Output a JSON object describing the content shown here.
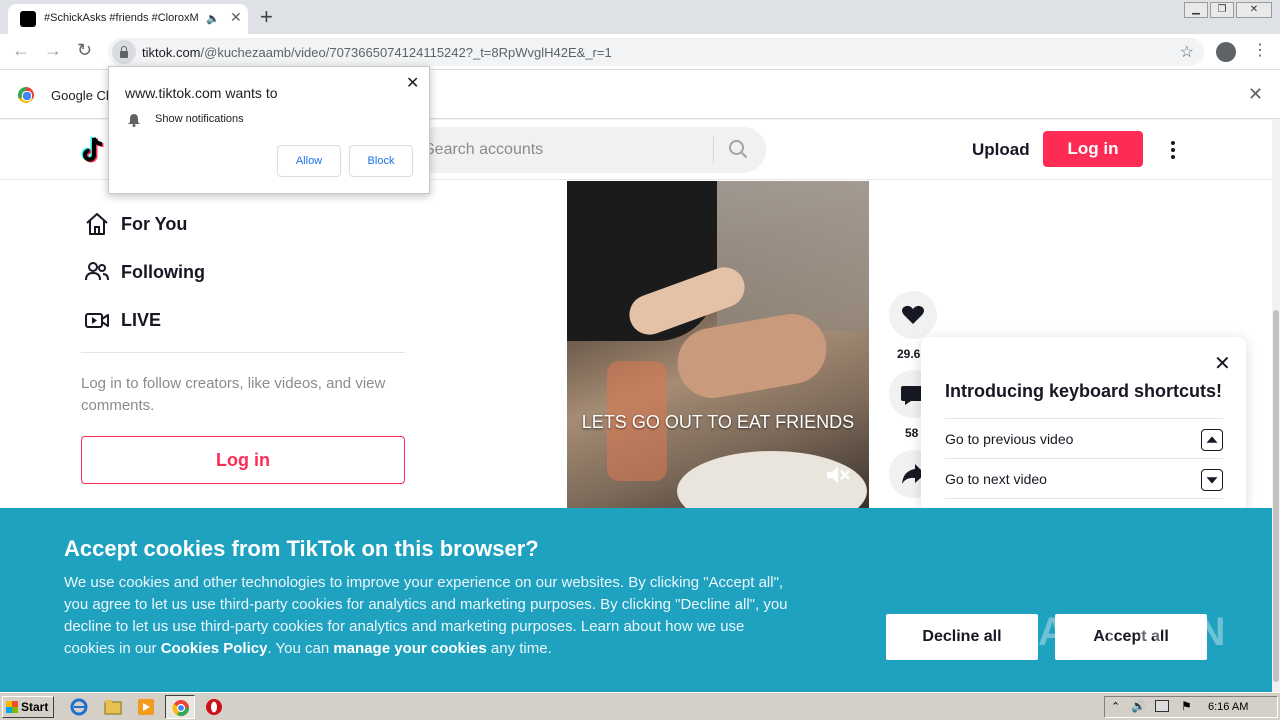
{
  "browser": {
    "tab_title": "#SchickAsks #friends #CloroxM",
    "tab_audio_icon": "speaker-icon",
    "url_host": "tiktok.com",
    "url_path": "/@kuchezaamb/video/7073665074124115242?_t=8RpWvglH42E&_r=1",
    "infobar_text": "Google Ch"
  },
  "permission_popup": {
    "origin": "www.tiktok.com wants to",
    "permission": "Show notifications",
    "allow_label": "Allow",
    "block_label": "Block"
  },
  "header": {
    "search_placeholder": "Search accounts",
    "upload_label": "Upload",
    "login_label": "Log in"
  },
  "sidebar": {
    "items": [
      {
        "label": "For You",
        "icon": "home-icon"
      },
      {
        "label": "Following",
        "icon": "following-icon"
      },
      {
        "label": "LIVE",
        "icon": "live-icon"
      }
    ],
    "message": "Log in to follow creators, like videos, and view comments.",
    "login_label": "Log in"
  },
  "video": {
    "caption": "LETS GO OUT TO EAT FRIENDS"
  },
  "actions": {
    "like_count": "29.6",
    "comment_count": "58"
  },
  "shortcuts": {
    "title": "Introducing keyboard shortcuts!",
    "rows": [
      {
        "label": "Go to previous video",
        "key": "up-arrow-key-icon"
      },
      {
        "label": "Go to next video",
        "key": "down-arrow-key-icon"
      }
    ]
  },
  "cookie": {
    "title": "Accept cookies from TikTok on this browser?",
    "body_1": "We use cookies and other technologies to improve your experience on our websites. By clicking \"Accept all\", you agree to let us use third-party cookies for analytics and marketing purposes. By clicking \"Decline all\", you decline to let us use third-party cookies for analytics and marketing purposes. Learn about how we use cookies in our ",
    "policy_link": "Cookies Policy",
    "body_2": ". You can ",
    "manage_link": "manage your cookies",
    "body_3": " any time.",
    "decline_label": "Decline all",
    "accept_label": "Accept all"
  },
  "watermark": "ANY RUN",
  "taskbar": {
    "start_label": "Start",
    "clock": "6:16 AM"
  },
  "colors": {
    "tiktok_red": "#fe2c55",
    "cookie_bg": "#1fa1c0"
  }
}
